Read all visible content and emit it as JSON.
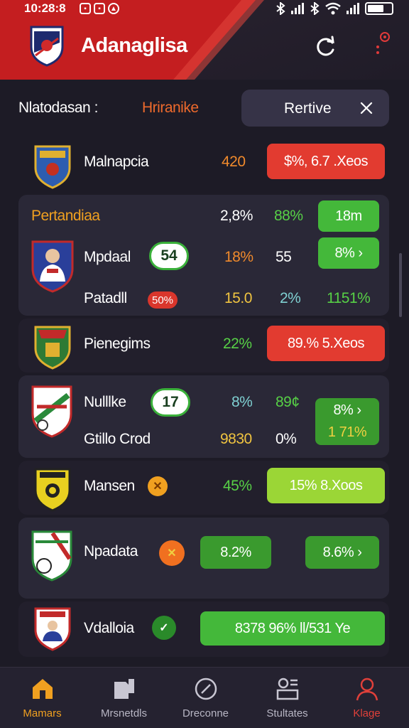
{
  "status_bar": {
    "time": "10:28:8",
    "left_icons": [
      "notification-icon",
      "notification-icon",
      "notification-icon"
    ],
    "right_icons": [
      "bluetooth-icon",
      "signal-icon",
      "bluetooth-icon",
      "wifi-icon",
      "signal-icon",
      "battery-icon"
    ]
  },
  "header": {
    "title": "Adanaglisa",
    "brand_red": "#c41e20",
    "actions": [
      "refresh-icon",
      "more-icon"
    ]
  },
  "filter": {
    "label": "Nlatodasan :",
    "value": "Hriranike",
    "chip_label": "Rertive",
    "accent": "#ee6a2c"
  },
  "rows": [
    {
      "team": "Malnapcia",
      "value": "420",
      "pill": "$%, 6.7 .Xeos"
    },
    {
      "section_title": "Pertandiaa",
      "section_values": [
        "2,8%",
        "88%"
      ],
      "section_pill": "18m",
      "team1": "Mpdaal",
      "badge1": "54",
      "v1a": "18%",
      "v1b": "55",
      "pill1": "8% ›",
      "team2": "Patadll",
      "badge2": "50%",
      "v2a": "15.0",
      "v2b": "2%",
      "v2c": "1151%"
    },
    {
      "team": "Pienegims",
      "value": "22%",
      "pill": "89.% 5.Xeos"
    },
    {
      "team1": "Nulllke",
      "badge1": "17",
      "v1a": "8%",
      "v1b": "89¢",
      "team2": "Gtillo Crod",
      "v2a": "9830",
      "v2b": "0%",
      "pill_top": "8% ›",
      "pill_bottom": "1 71%"
    },
    {
      "team": "Mansen",
      "value": "45%",
      "pill": "15% 8.Xoos"
    },
    {
      "team": "Npadata",
      "pill1": "8.2%",
      "pill2": "8.6% ›"
    },
    {
      "team": "Vdalloia",
      "pill": "8378  96% ll/531 Ye"
    }
  ],
  "tabs": [
    {
      "label": "Mamars",
      "icon": "home-icon",
      "state": "active"
    },
    {
      "label": "Mrsnetdls",
      "icon": "document-icon",
      "state": "normal"
    },
    {
      "label": "Dreconne",
      "icon": "compass-icon",
      "state": "normal"
    },
    {
      "label": "Stultates",
      "icon": "stats-icon",
      "state": "normal"
    },
    {
      "label": "Klage",
      "icon": "profile-icon",
      "state": "alert"
    }
  ]
}
